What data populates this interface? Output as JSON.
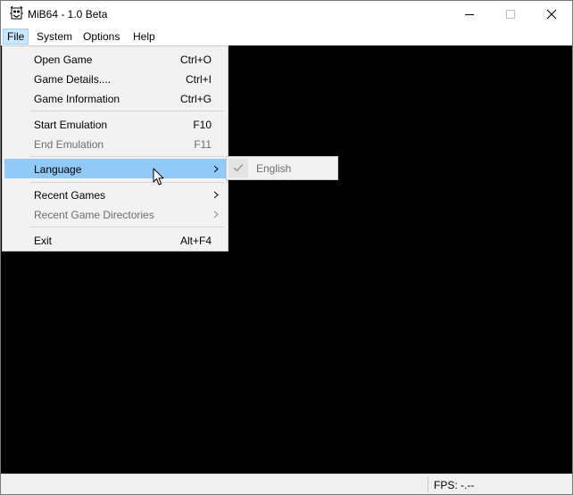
{
  "window": {
    "title": "MiB64 - 1.0 Beta"
  },
  "menubar": {
    "items": [
      {
        "label": "File"
      },
      {
        "label": "System"
      },
      {
        "label": "Options"
      },
      {
        "label": "Help"
      }
    ]
  },
  "file_menu": {
    "items": [
      {
        "label": "Open Game",
        "shortcut": "Ctrl+O"
      },
      {
        "label": "Game Details....",
        "shortcut": "Ctrl+I"
      },
      {
        "label": "Game Information",
        "shortcut": "Ctrl+G"
      },
      {
        "label": "Start Emulation",
        "shortcut": "F10"
      },
      {
        "label": "End Emulation",
        "shortcut": "F11"
      },
      {
        "label": "Language"
      },
      {
        "label": "Recent Games"
      },
      {
        "label": "Recent Game Directories"
      },
      {
        "label": "Exit",
        "shortcut": "Alt+F4"
      }
    ]
  },
  "language_submenu": {
    "items": [
      {
        "label": "English"
      }
    ]
  },
  "statusbar": {
    "fps": "FPS: -.--"
  },
  "colors": {
    "menu_highlight": "#91c9f7",
    "menubar_active": "#cce8ff",
    "client_area": "#000000",
    "disabled_text": "#6d6d6d"
  },
  "icons": [
    "app-icon",
    "minimize-icon",
    "maximize-icon",
    "close-icon",
    "chevron-right-icon",
    "checkmark-icon",
    "mouse-cursor-icon"
  ]
}
